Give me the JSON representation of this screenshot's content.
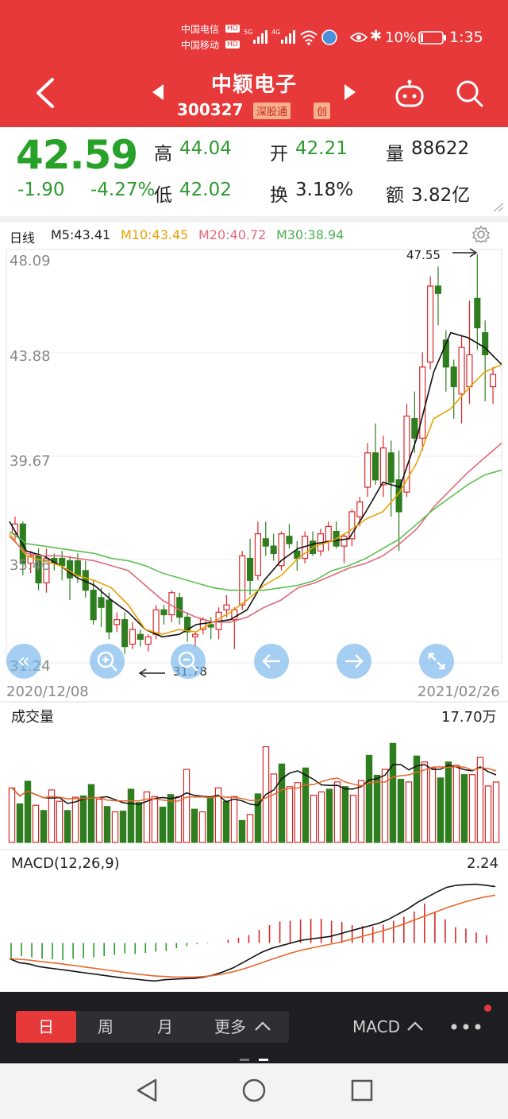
{
  "status_bar": {
    "carrier1": "中国电信",
    "carrier2": "中国移动",
    "hd": "HD",
    "net1": "5G",
    "net2": "4G",
    "battery": "10%",
    "time": "1:35"
  },
  "header": {
    "stock_name": "中颖电子",
    "stock_code": "300327",
    "tag_connect": "深股通",
    "tag_board": "创"
  },
  "quote": {
    "price": "42.59",
    "change": "-1.90",
    "change_pct": "-4.27%",
    "high_label": "高",
    "high": "44.04",
    "low_label": "低",
    "low": "42.02",
    "open_label": "开",
    "open": "42.21",
    "turnover_label": "换",
    "turnover": "3.18%",
    "volume_label": "量",
    "volume": "88622",
    "amount_label": "额",
    "amount": "3.82亿"
  },
  "legend": {
    "period": "日线",
    "m5": "M5:43.41",
    "m10": "M10:43.45",
    "m20": "M20:40.72",
    "m30": "M30:38.94"
  },
  "colors": {
    "up": "#d8282a",
    "down": "#2e7d1e",
    "m5": "#111111",
    "m10": "#e8a100",
    "m20": "#e06a7c",
    "m30": "#5cbf4f"
  },
  "chart_data": [
    {
      "type": "candlestick",
      "y_ticks": [
        "48.09",
        "43.88",
        "39.67",
        "35.46",
        "31.24"
      ],
      "ylim": [
        31.24,
        48.09
      ],
      "x_start": "2020/12/08",
      "x_end": "2021/02/26",
      "max_marker": "47.55",
      "min_marker": "31.78",
      "candles": [
        [
          36.5,
          37.2,
          36.2,
          36.9
        ],
        [
          36.9,
          37.0,
          34.8,
          35.3
        ],
        [
          35.3,
          35.8,
          34.9,
          35.6
        ],
        [
          35.6,
          35.9,
          34.2,
          34.5
        ],
        [
          34.5,
          35.9,
          34.1,
          35.5
        ],
        [
          35.5,
          35.7,
          35.0,
          35.3
        ],
        [
          35.5,
          35.8,
          34.6,
          35.2
        ],
        [
          35.4,
          35.6,
          33.8,
          34.7
        ],
        [
          35.4,
          35.7,
          34.5,
          34.8
        ],
        [
          35.0,
          35.4,
          33.9,
          34.2
        ],
        [
          34.2,
          34.6,
          32.8,
          33.0
        ],
        [
          33.9,
          34.3,
          32.7,
          33.5
        ],
        [
          33.8,
          34.1,
          32.2,
          32.5
        ],
        [
          32.8,
          33.3,
          32.5,
          33.0
        ],
        [
          33.0,
          33.3,
          31.6,
          31.9
        ],
        [
          32.0,
          32.9,
          31.8,
          32.6
        ],
        [
          32.4,
          32.6,
          31.9,
          32.2
        ],
        [
          32.0,
          32.4,
          31.7,
          32.3
        ],
        [
          32.4,
          33.6,
          32.2,
          33.4
        ],
        [
          33.4,
          33.6,
          32.8,
          33.2
        ],
        [
          33.2,
          34.2,
          32.9,
          34.1
        ],
        [
          33.9,
          34.1,
          32.8,
          33.1
        ],
        [
          33.1,
          33.3,
          32.1,
          32.5
        ],
        [
          32.3,
          32.5,
          31.9,
          32.4
        ],
        [
          32.6,
          33.1,
          32.4,
          33.0
        ],
        [
          32.8,
          33.1,
          32.2,
          32.7
        ],
        [
          32.6,
          33.5,
          32.2,
          33.3
        ],
        [
          33.4,
          34.0,
          33.1,
          33.6
        ],
        [
          33.0,
          33.5,
          31.8,
          33.4
        ],
        [
          33.6,
          35.8,
          33.4,
          35.6
        ],
        [
          35.5,
          36.3,
          34.0,
          34.6
        ],
        [
          34.8,
          37.0,
          34.6,
          36.5
        ],
        [
          36.3,
          37.0,
          35.6,
          36.0
        ],
        [
          36.0,
          36.5,
          35.4,
          35.7
        ],
        [
          35.2,
          36.6,
          35.0,
          36.5
        ],
        [
          36.4,
          36.9,
          35.9,
          36.1
        ],
        [
          35.8,
          36.2,
          35.0,
          35.5
        ],
        [
          35.5,
          36.6,
          35.3,
          36.4
        ],
        [
          36.2,
          36.6,
          35.6,
          35.7
        ],
        [
          35.8,
          36.7,
          35.6,
          36.5
        ],
        [
          36.2,
          37.0,
          35.8,
          36.8
        ],
        [
          36.6,
          37.0,
          35.9,
          36.0
        ],
        [
          36.0,
          36.5,
          35.3,
          36.4
        ],
        [
          36.3,
          37.5,
          36.0,
          37.4
        ],
        [
          37.2,
          38.0,
          36.8,
          37.8
        ],
        [
          38.4,
          40.2,
          38.0,
          39.8
        ],
        [
          39.8,
          41.0,
          38.5,
          38.7
        ],
        [
          38.5,
          40.5,
          38.0,
          40.0
        ],
        [
          39.8,
          40.3,
          37.2,
          38.6
        ],
        [
          38.7,
          39.9,
          35.8,
          37.4
        ],
        [
          38.2,
          41.8,
          38.0,
          41.3
        ],
        [
          41.2,
          42.3,
          39.8,
          40.4
        ],
        [
          40.4,
          43.9,
          39.9,
          43.3
        ],
        [
          43.5,
          47.0,
          43.2,
          46.6
        ],
        [
          46.6,
          47.4,
          45.0,
          46.3
        ],
        [
          44.4,
          44.8,
          42.3,
          43.3
        ],
        [
          43.3,
          43.6,
          41.2,
          42.5
        ],
        [
          42.2,
          44.6,
          41.0,
          44.1
        ],
        [
          42.5,
          46.0,
          41.8,
          43.8
        ],
        [
          46.1,
          47.9,
          44.0,
          44.9
        ],
        [
          44.7,
          45.2,
          41.9,
          43.8
        ],
        [
          42.5,
          43.3,
          41.8,
          43.0
        ]
      ],
      "ma": {
        "m5": [
          [
            37.0,
            35.8
          ],
          [
            37.3,
            35.6
          ],
          [
            36.9,
            35.2
          ],
          [
            36.2,
            34.7
          ],
          [
            35.5,
            34.4
          ],
          [
            35.1,
            33.8
          ],
          [
            34.8,
            33.3
          ],
          [
            33.9,
            32.6
          ],
          [
            33.2,
            32.3
          ],
          [
            32.6,
            32.4
          ],
          [
            32.4,
            32.8
          ],
          [
            32.7,
            32.9
          ],
          [
            33.2,
            33.0
          ],
          [
            33.4,
            33.4
          ],
          [
            33.6,
            34.6
          ],
          [
            34.9,
            35.4
          ],
          [
            35.8,
            35.9
          ],
          [
            36.4,
            36.1
          ],
          [
            36.4,
            36.2
          ],
          [
            36.5,
            36.3
          ],
          [
            37.0,
            37.4
          ],
          [
            38.5,
            38.6
          ],
          [
            39.2,
            38.4
          ],
          [
            39.7,
            40.4
          ],
          [
            41.6,
            43.1
          ],
          [
            44.4,
            44.7
          ],
          [
            45.1,
            44.5
          ],
          [
            44.6,
            44.1
          ],
          [
            43.7,
            43.4
          ]
        ],
        "m10": [
          [
            36.5,
            35.6
          ],
          [
            36.5,
            35.4
          ],
          [
            36.2,
            35.2
          ],
          [
            35.7,
            34.8
          ],
          [
            35.2,
            34.6
          ],
          [
            34.9,
            34.3
          ],
          [
            34.5,
            33.6
          ],
          [
            33.8,
            32.6
          ],
          [
            33.0,
            32.4
          ],
          [
            32.6,
            32.6
          ],
          [
            32.6,
            32.5
          ],
          [
            32.8,
            32.9
          ],
          [
            33.2,
            33.3
          ],
          [
            34.0,
            33.8
          ],
          [
            34.8,
            34.4
          ],
          [
            35.4,
            34.8
          ],
          [
            35.9,
            35.5
          ],
          [
            36.2,
            36.0
          ],
          [
            36.5,
            36.2
          ],
          [
            36.8,
            36.6
          ],
          [
            37.4,
            37.1
          ],
          [
            38.1,
            37.4
          ],
          [
            38.5,
            38.2
          ],
          [
            39.6,
            39.4
          ],
          [
            40.7,
            41.2
          ],
          [
            42.0,
            41.6
          ],
          [
            42.7,
            42.4
          ],
          [
            43.4,
            43.1
          ],
          [
            43.9,
            43.4
          ]
        ],
        "m20": [
          [
            36.4,
            35.7
          ],
          [
            36.4,
            35.6
          ],
          [
            36.3,
            35.6
          ],
          [
            36.2,
            35.5
          ],
          [
            36.0,
            35.4
          ],
          [
            35.8,
            35.2
          ],
          [
            35.6,
            35.0
          ],
          [
            35.2,
            34.4
          ],
          [
            34.6,
            33.8
          ],
          [
            33.9,
            33.4
          ],
          [
            33.5,
            33.1
          ],
          [
            33.3,
            32.9
          ],
          [
            33.2,
            32.9
          ],
          [
            33.2,
            33.1
          ],
          [
            33.3,
            33.5
          ],
          [
            33.5,
            33.8
          ],
          [
            33.9,
            34.3
          ],
          [
            34.2,
            34.5
          ],
          [
            34.6,
            34.8
          ],
          [
            34.9,
            35.1
          ],
          [
            35.2,
            35.3
          ],
          [
            35.5,
            35.6
          ],
          [
            35.9,
            36.1
          ],
          [
            36.3,
            36.7
          ],
          [
            37.0,
            37.6
          ],
          [
            37.9,
            38.3
          ],
          [
            38.8,
            39.0
          ],
          [
            39.7,
            39.6
          ],
          [
            40.4,
            40.2
          ]
        ],
        "m30": [
          [
            36.6,
            36.1
          ],
          [
            36.5,
            36.0
          ],
          [
            36.4,
            35.9
          ],
          [
            36.2,
            35.8
          ],
          [
            36.0,
            35.7
          ],
          [
            35.8,
            35.5
          ],
          [
            35.7,
            35.4
          ],
          [
            35.4,
            35.2
          ],
          [
            35.1,
            34.9
          ],
          [
            34.7,
            34.7
          ],
          [
            34.5,
            34.5
          ],
          [
            34.3,
            34.3
          ],
          [
            34.2,
            34.2
          ],
          [
            34.1,
            34.2
          ],
          [
            34.1,
            34.2
          ],
          [
            34.2,
            34.3
          ],
          [
            34.3,
            34.4
          ],
          [
            34.5,
            34.6
          ],
          [
            34.8,
            35.0
          ],
          [
            35.0,
            35.2
          ],
          [
            35.3,
            35.5
          ],
          [
            35.7,
            35.9
          ],
          [
            36.0,
            36.3
          ],
          [
            36.6,
            36.9
          ],
          [
            37.2,
            37.5
          ],
          [
            37.8,
            38.0
          ],
          [
            38.3,
            38.5
          ],
          [
            38.7,
            38.9
          ],
          [
            39.0,
            39.1
          ]
        ]
      }
    },
    {
      "type": "bar",
      "title": "成交量",
      "max_label": "17.70万",
      "ylim": [
        0,
        17.7
      ],
      "values": [
        8.2,
        5.8,
        9.2,
        5.6,
        4.8,
        7.9,
        6.2,
        4.8,
        6.8,
        7.0,
        8.7,
        6.5,
        5.4,
        4.6,
        4.7,
        8.0,
        6.0,
        7.6,
        6.9,
        5.3,
        7.2,
        6.9,
        11.0,
        5.0,
        4.6,
        6.7,
        8.2,
        6.2,
        6.9,
        3.3,
        4.2,
        7.3,
        14.4,
        10.3,
        11.8,
        8.4,
        9.0,
        11.2,
        7.1,
        7.6,
        8.0,
        9.1,
        8.4,
        7.1,
        9.3,
        13.1,
        10.1,
        11.0,
        14.9,
        9.5,
        9.1,
        13.0,
        12.1,
        11.2,
        9.7,
        12.1,
        11.6,
        10.2,
        10.2,
        12.8,
        8.5,
        9.1
      ],
      "up_flags": [
        1,
        0,
        0,
        1,
        0,
        1,
        1,
        0,
        1,
        0,
        0,
        1,
        0,
        1,
        0,
        0,
        0,
        1,
        1,
        0,
        0,
        1,
        1,
        0,
        1,
        0,
        1,
        0,
        1,
        0,
        1,
        0,
        1,
        1,
        0,
        1,
        1,
        0,
        1,
        1,
        0,
        1,
        0,
        1,
        1,
        0,
        0,
        1,
        0,
        0,
        1,
        0,
        1,
        1,
        0,
        0,
        1,
        0,
        1,
        1,
        1,
        1
      ]
    },
    {
      "type": "line",
      "title": "MACD(12,26,9)",
      "max_label": "2.24",
      "ylim": [
        -1.5,
        2.5
      ],
      "dif": [
        -0.6,
        -0.75,
        -0.8,
        -0.9,
        -0.95,
        -1.0,
        -1.05,
        -1.1,
        -1.15,
        -1.2,
        -1.25,
        -1.3,
        -1.35,
        -1.38,
        -1.42,
        -1.45,
        -1.4,
        -1.38,
        -1.36,
        -1.35,
        -1.3,
        -1.22,
        -1.1,
        -0.95,
        -0.75,
        -0.55,
        -0.35,
        -0.2,
        -0.1,
        0.0,
        0.1,
        0.15,
        0.2,
        0.25,
        0.35,
        0.45,
        0.55,
        0.65,
        0.75,
        0.9,
        1.1,
        1.3,
        1.55,
        1.75,
        1.95,
        2.12,
        2.2,
        2.22,
        2.24,
        2.2,
        2.15
      ],
      "dea": [
        -0.6,
        -0.62,
        -0.65,
        -0.7,
        -0.74,
        -0.78,
        -0.83,
        -0.88,
        -0.93,
        -0.98,
        -1.03,
        -1.08,
        -1.13,
        -1.18,
        -1.22,
        -1.26,
        -1.28,
        -1.3,
        -1.3,
        -1.3,
        -1.28,
        -1.24,
        -1.18,
        -1.1,
        -1.0,
        -0.88,
        -0.75,
        -0.62,
        -0.5,
        -0.38,
        -0.28,
        -0.2,
        -0.12,
        -0.05,
        0.03,
        0.12,
        0.22,
        0.32,
        0.42,
        0.53,
        0.65,
        0.78,
        0.92,
        1.06,
        1.2,
        1.34,
        1.46,
        1.58,
        1.68,
        1.76,
        1.82
      ],
      "hist": [
        -0.6,
        -0.5,
        -0.55,
        -0.6,
        -0.62,
        -0.65,
        -0.6,
        -0.58,
        -0.55,
        -0.5,
        -0.45,
        -0.4,
        -0.42,
        -0.38,
        -0.33,
        -0.3,
        -0.2,
        -0.12,
        -0.05,
        -0.02,
        0.0,
        0.12,
        0.2,
        0.3,
        0.5,
        0.68,
        0.82,
        0.85,
        0.9,
        0.92,
        0.92,
        0.85,
        0.8,
        0.68,
        0.65,
        0.62,
        0.7,
        0.85,
        1.0,
        1.2,
        1.5,
        1.2,
        0.9,
        0.6,
        0.55,
        0.4,
        0.3
      ]
    }
  ],
  "tabs": {
    "day": "日",
    "week": "周",
    "month": "月",
    "more": "更多",
    "indicator": "MACD"
  },
  "nav": {}
}
